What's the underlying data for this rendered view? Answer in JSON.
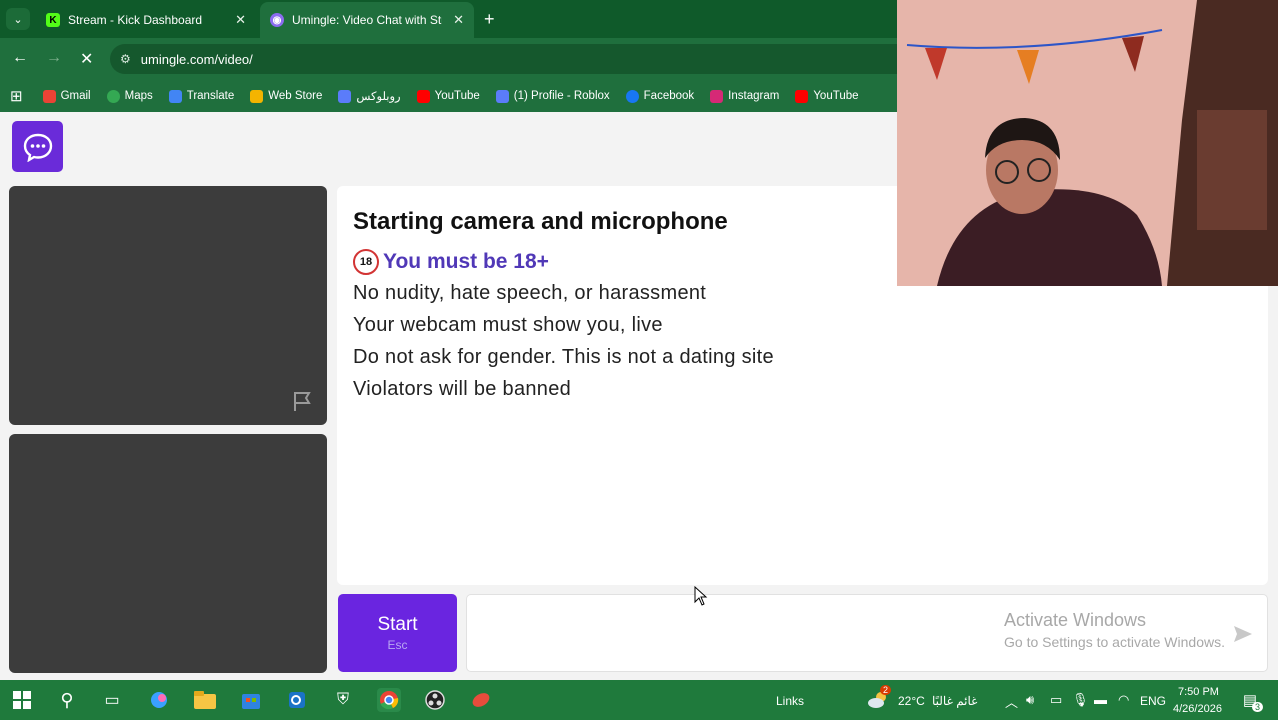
{
  "browser": {
    "tabs": [
      {
        "title": "Stream - Kick Dashboard",
        "favicon": "kick-icon"
      },
      {
        "title": "Umingle: Video Chat with Stran",
        "favicon": "umingle-icon",
        "active": true
      }
    ],
    "url": "umingle.com/video/",
    "bookmarks": [
      {
        "label": "Gmail",
        "icon": "gmail-icon",
        "color": "#ea4335"
      },
      {
        "label": "Maps",
        "icon": "maps-icon",
        "color": "#34a853"
      },
      {
        "label": "Translate",
        "icon": "translate-icon",
        "color": "#4285f4"
      },
      {
        "label": "Web Store",
        "icon": "webstore-icon",
        "color": "#f4b400"
      },
      {
        "label": "روبلوكس",
        "icon": "roblox-icon",
        "color": "#5b7cfa"
      },
      {
        "label": "YouTube",
        "icon": "youtube-icon",
        "color": "#ff0000"
      },
      {
        "label": "(1) Profile - Roblox",
        "icon": "roblox-icon",
        "color": "#5b7cfa"
      },
      {
        "label": "Facebook",
        "icon": "facebook-icon",
        "color": "#1877f2"
      },
      {
        "label": "Instagram",
        "icon": "instagram-icon",
        "color": "#d62976"
      },
      {
        "label": "YouTube",
        "icon": "youtube-icon",
        "color": "#ff0000"
      }
    ]
  },
  "page": {
    "title": "Starting camera and microphone",
    "age_badge": "18",
    "age_notice": "You must be 18+",
    "rules": [
      "No nudity, hate speech, or harassment",
      "Your webcam must show you, live",
      "Do not ask for gender. This is not a dating site",
      "Violators will be banned"
    ],
    "start_button": {
      "label": "Start",
      "shortcut": "Esc"
    },
    "activate_windows": {
      "title": "Activate Windows",
      "subtitle": "Go to Settings to activate Windows."
    },
    "colors": {
      "brand": "#6a25e0",
      "notice": "#5038b7"
    }
  },
  "taskbar": {
    "links_label": "Links",
    "weather": "22°C",
    "weather_desc": "غائم غالبًا",
    "language": "ENG",
    "time": "7:50 PM",
    "date": "4/26/2026",
    "weather_badge": "2",
    "notification_count": "3"
  }
}
